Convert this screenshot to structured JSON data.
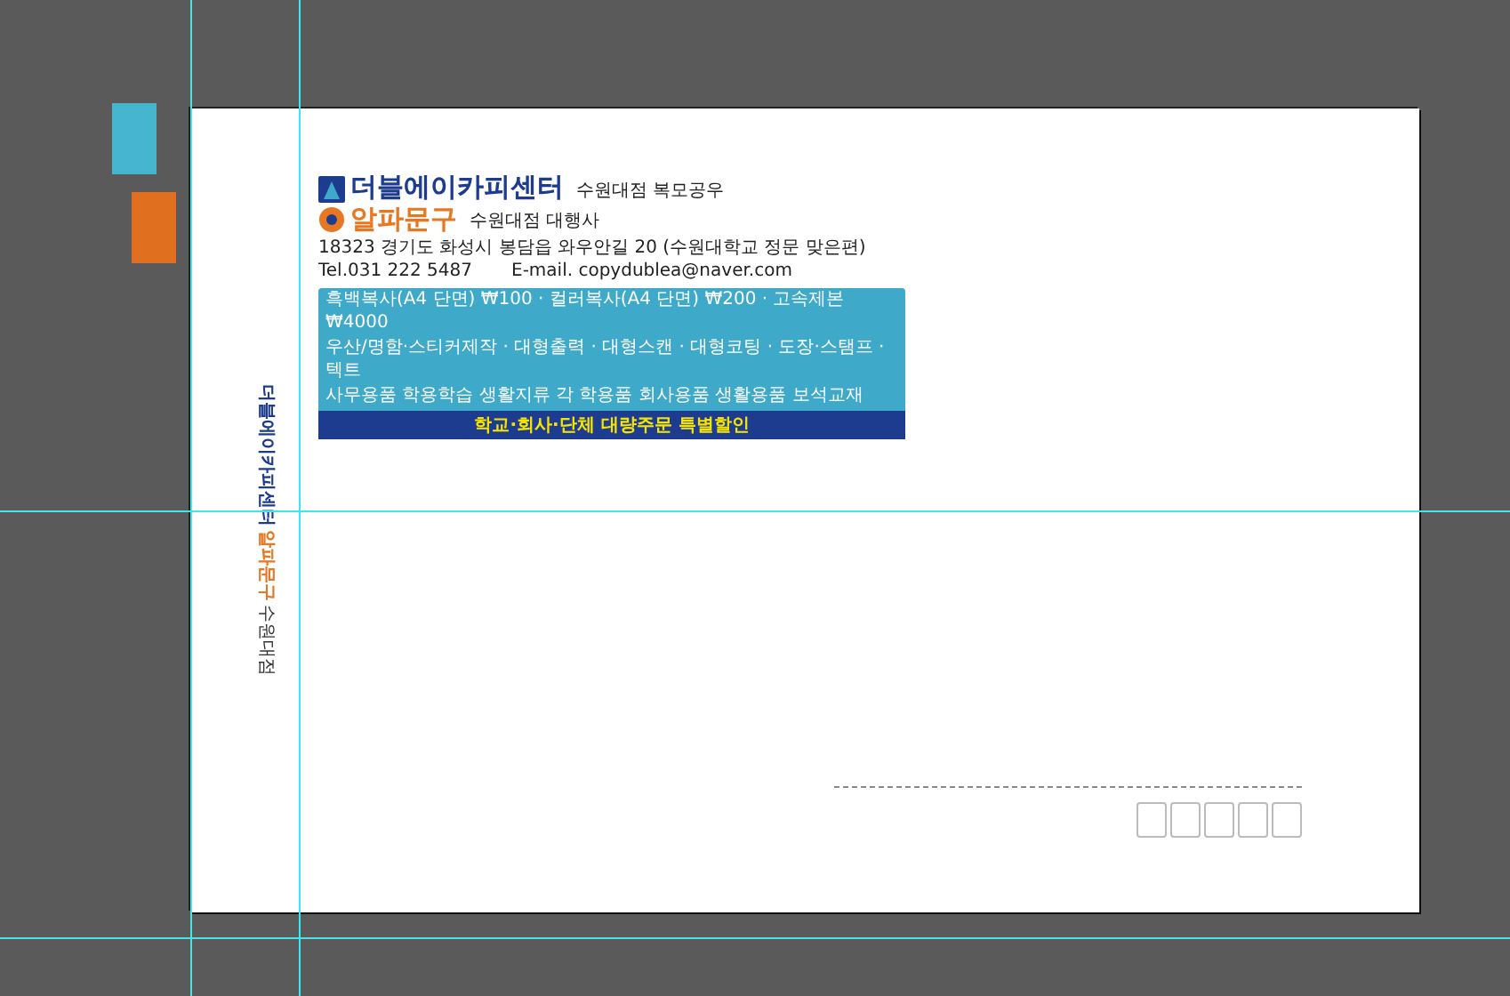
{
  "swatches": [
    {
      "color": "#45b5d0"
    },
    {
      "color": "#e07020"
    }
  ],
  "letterhead": {
    "brand_1": {
      "name": "더블에이카피센터",
      "tagline": "수원대점 복모공우"
    },
    "brand_2": {
      "name": "알파문구",
      "tagline": "수원대점 대행사"
    },
    "address": "18323  경기도 화성시 봉담읍 와우안길 20 (수원대학교 정문 맞은편)",
    "phone": "Tel.031 222 5487",
    "email": "E-mail. copydublea@naver.com",
    "banner_lines": [
      "흑백복사(A4 단면) ₩100 · 컬러복사(A4 단면) ₩200 · 고속제본 ₩4000",
      "우산/명함·스티커제작 · 대형출력 · 대형스캔 · 대형코팅 · 도장·스탬프 · 텍트",
      "사무용품  학용학습  생활지류  각 학용품  회사용품  생활용품  보석교재"
    ],
    "banner_footer": "학교·회사·단체 대량주문 특별할인"
  },
  "side_logo": {
    "name_1": "더블에이카피센터",
    "name_2": "알파문구",
    "tagline": "수원대점"
  }
}
